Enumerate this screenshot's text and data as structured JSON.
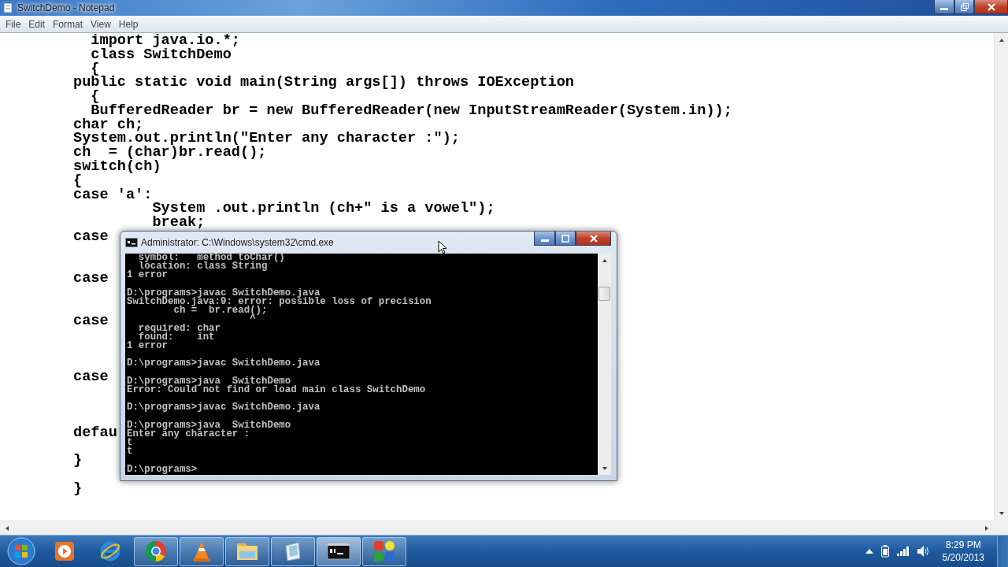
{
  "notepad": {
    "title": "SwitchDemo - Notepad",
    "menu": [
      "File",
      "Edit",
      "Format",
      "View",
      "Help"
    ],
    "text": "  import java.io.*;\n  class SwitchDemo\n  {\npublic static void main(String args[]) throws IOException\n  {\n  BufferedReader br = new BufferedReader(new InputStreamReader(System.in));\nchar ch;\nSystem.out.println(\"Enter any character :\");\nch  = (char)br.read();\nswitch(ch)\n{\ncase 'a':\n         System .out.println (ch+\" is a vowel\");\n         break;\ncase\n\n\ncase\n\n\ncase\n\n\n\ncase\n\n\n\ndefau\n\n}\n\n}"
  },
  "cmd": {
    "title": "Administrator: C:\\Windows\\system32\\cmd.exe",
    "output": "  symbol:   method toChar()\n  location: class String\n1 error\n\nD:\\programs>javac SwitchDemo.java\nSwitchDemo.java:9: error: possible loss of precision\n        ch =  br.read();\n                     ^\n  required: char\n  found:    int\n1 error\n\nD:\\programs>javac SwitchDemo.java\n\nD:\\programs>java  SwitchDemo\nError: Could not find or load main class SwitchDemo\n\nD:\\programs>javac SwitchDemo.java\n\nD:\\programs>java  SwitchDemo\nEnter any character :\nt\nt\n\nD:\\programs>"
  },
  "taskbar": {
    "items": [
      {
        "kind": "media-player",
        "running": false,
        "selected": false
      },
      {
        "kind": "browser-e",
        "running": false,
        "selected": false
      },
      {
        "kind": "browser-ring",
        "running": true,
        "selected": false
      },
      {
        "kind": "cone",
        "running": true,
        "selected": false
      },
      {
        "kind": "folder",
        "running": true,
        "selected": false
      },
      {
        "kind": "notepad",
        "running": true,
        "selected": false
      },
      {
        "kind": "console",
        "running": true,
        "selected": true
      },
      {
        "kind": "tiles",
        "running": true,
        "selected": false
      }
    ],
    "time": "8:29 PM",
    "date": "5/20/2013"
  }
}
